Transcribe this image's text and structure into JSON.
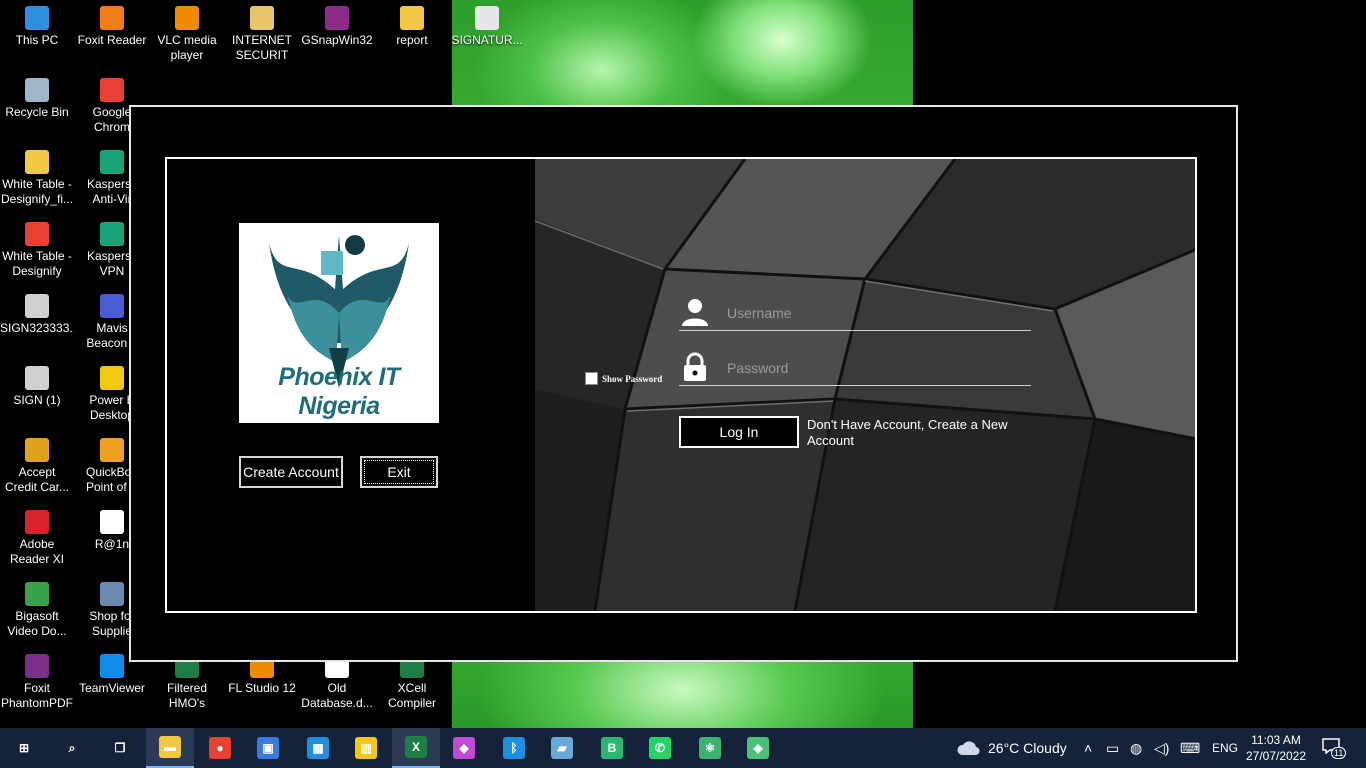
{
  "desktop": {
    "icons": [
      {
        "label": "This PC",
        "icon": "computer-icon",
        "color": "#2f8fe0"
      },
      {
        "label": "Foxit Reader",
        "icon": "foxit-icon",
        "color": "#f07d1a"
      },
      {
        "label": "VLC media\nplayer",
        "icon": "vlc-icon",
        "color": "#f08a00"
      },
      {
        "label": "INTERNET\nSECURIT",
        "icon": "folder-icon",
        "color": "#e9c46a"
      },
      {
        "label": "GSnapWin32",
        "icon": "archive-icon",
        "color": "#8e2b8a"
      },
      {
        "label": "report",
        "icon": "folder-icon",
        "color": "#f2c744"
      },
      {
        "label": "SIGNATUR...",
        "icon": "image-icon",
        "color": "#e6e6e6"
      },
      {
        "label": "Recycle Bin",
        "icon": "recycle-bin-icon",
        "color": "#9fb6c8"
      },
      {
        "label": "Google\nChrom",
        "icon": "chrome-icon",
        "color": "#e94235"
      },
      {
        "label": "White Table -\nDesignify_fi...",
        "icon": "file-icon",
        "color": "#f2c744"
      },
      {
        "label": "Kaspersk\nAnti-Vir",
        "icon": "kaspersky-icon",
        "color": "#1aa37a"
      },
      {
        "label": "White Table -\nDesignify",
        "icon": "chrome-icon",
        "color": "#e94235"
      },
      {
        "label": "Kaspersk\nVPN",
        "icon": "kaspersky-vpn-icon",
        "color": "#1aa37a"
      },
      {
        "label": "SIGN323333...",
        "icon": "image-icon",
        "color": "#d0d0d0"
      },
      {
        "label": "Mavis\nBeacon T",
        "icon": "mavis-icon",
        "color": "#4a5bd4"
      },
      {
        "label": "SIGN (1)",
        "icon": "image-icon",
        "color": "#d0d0d0"
      },
      {
        "label": "Power B\nDesktop",
        "icon": "powerbi-icon",
        "color": "#f2c811"
      },
      {
        "label": "Accept\nCredit Car...",
        "icon": "credit-card-icon",
        "color": "#e0a020"
      },
      {
        "label": "QuickBoo\nPoint of S",
        "icon": "quickbooks-icon",
        "color": "#f0a020"
      },
      {
        "label": "Adobe\nReader XI",
        "icon": "adobe-icon",
        "color": "#d8232a"
      },
      {
        "label": "R@1n",
        "icon": "document-icon",
        "color": "#ffffff"
      },
      {
        "label": "Bigasoft\nVideo Do...",
        "icon": "bigasoft-icon",
        "color": "#3aa04a"
      },
      {
        "label": "Shop for\nSupplie",
        "icon": "printer-icon",
        "color": "#6a8ab0"
      },
      {
        "label": "Foxit\nPhantomPDF",
        "icon": "foxit-phantom-icon",
        "color": "#7a2f8a"
      },
      {
        "label": "TeamViewer",
        "icon": "teamviewer-icon",
        "color": "#0e8ee9"
      },
      {
        "label": "Filtered\nHMO's",
        "icon": "excel-file-icon",
        "color": "#1e7e45"
      },
      {
        "label": "FL Studio 12",
        "icon": "fl-studio-icon",
        "color": "#f08a00"
      },
      {
        "label": "Old\nDatabase.d...",
        "icon": "document-icon",
        "color": "#ffffff"
      },
      {
        "label": "XCell\nCompiler",
        "icon": "xcell-icon",
        "color": "#1e7e45"
      }
    ]
  },
  "app": {
    "logo_text": "Phoenix IT Nigeria",
    "create_account_label": "Create Account",
    "exit_label": "Exit",
    "username_placeholder": "Username",
    "password_placeholder": "Password",
    "show_password_label": "Show Password",
    "login_label": "Log In",
    "create_link_text": "Don't Have Account, Create a New Account"
  },
  "taskbar": {
    "apps": [
      {
        "icon": "windows-start-icon",
        "glyph": "⊞",
        "color": "#14223a"
      },
      {
        "icon": "search-icon",
        "glyph": "⌕",
        "color": "#14223a"
      },
      {
        "icon": "task-view-icon",
        "glyph": "❐",
        "color": "#14223a"
      },
      {
        "icon": "file-explorer-icon",
        "glyph": "▬",
        "color": "#f2c744"
      },
      {
        "icon": "chrome-icon",
        "glyph": "●",
        "color": "#e94235"
      },
      {
        "icon": "store-icon",
        "glyph": "▣",
        "color": "#3a7be0"
      },
      {
        "icon": "calculator-icon",
        "glyph": "▦",
        "color": "#1e90e0"
      },
      {
        "icon": "powerbi-icon",
        "glyph": "▥",
        "color": "#f2c811"
      },
      {
        "icon": "excel-icon",
        "glyph": "X",
        "color": "#1e7e45"
      },
      {
        "icon": "paint-icon",
        "glyph": "◆",
        "color": "#c04ad8"
      },
      {
        "icon": "bluetooth-icon",
        "glyph": "ᛒ",
        "color": "#1e90e0"
      },
      {
        "icon": "notes-icon",
        "glyph": "▰",
        "color": "#6aa8d8"
      },
      {
        "icon": "bluestacks-icon",
        "glyph": "B",
        "color": "#2bb673"
      },
      {
        "icon": "whatsapp-icon",
        "glyph": "✆",
        "color": "#25d366"
      },
      {
        "icon": "atom-icon",
        "glyph": "⚛",
        "color": "#3cb371"
      },
      {
        "icon": "app-icon",
        "glyph": "◈",
        "color": "#4cbf7a"
      }
    ],
    "weather": "26°C  Cloudy",
    "language": "ENG",
    "time": "11:03 AM",
    "date": "27/07/2022",
    "notification_count": "11"
  }
}
